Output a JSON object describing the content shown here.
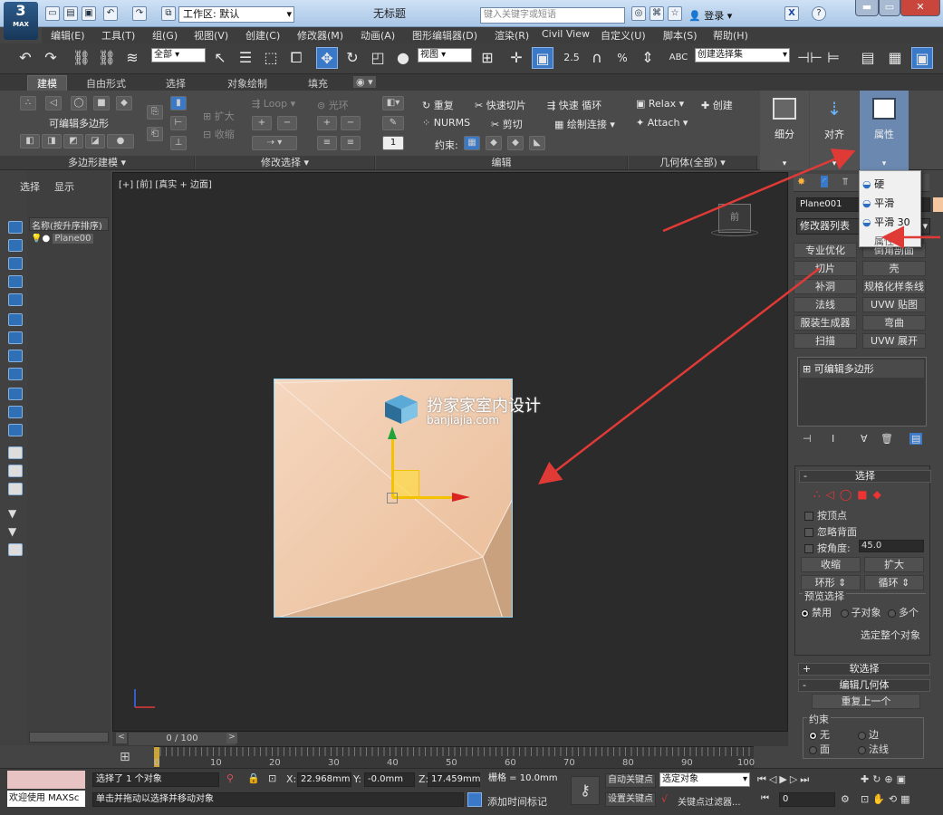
{
  "app": {
    "logo_label": "MAX",
    "workspace_label": "工作区: 默认",
    "window_title": "无标题",
    "search_placeholder": "键入关键字或短语",
    "login_label": "登录",
    "help_label": "?"
  },
  "menu": [
    "编辑(E)",
    "工具(T)",
    "组(G)",
    "视图(V)",
    "创建(C)",
    "修改器(M)",
    "动画(A)",
    "图形编辑器(D)",
    "渲染(R)",
    "Civil View",
    "自定义(U)",
    "脚本(S)",
    "帮助(H)"
  ],
  "toolbar": {
    "selection_filter": "全部",
    "ref_coord": "视图",
    "snap_labels": [
      "2.5",
      "%"
    ],
    "named_selection": "创建选择集"
  },
  "ribbon_tabs": [
    "建模",
    "自由形式",
    "选择",
    "对象绘制",
    "填充"
  ],
  "ribbon": {
    "poly_modeling": {
      "title": "可编辑多边形",
      "panel_label": "多边形建模"
    },
    "modify_selection": {
      "panel_label": "修改选择",
      "grow": "扩大",
      "shrink": "收缩",
      "loop": "Loop",
      "ring": "光环"
    },
    "edit": {
      "panel_label": "编辑",
      "repeat": "重复",
      "quickslice": "快速切片",
      "swiftloop": "快速 循环",
      "nurms": "NURMS",
      "cut": "剪切",
      "paintconnect": "绘制连接",
      "constraints_label": "约束:",
      "spinner_value": "1"
    },
    "geometry": {
      "panel_label": "几何体(全部)",
      "relax": "Relax",
      "create": "创建",
      "attach": "Attach"
    },
    "subdivision": "细分",
    "align": "对齐",
    "properties": "属性"
  },
  "properties_menu": {
    "items": [
      "硬",
      "平滑",
      "平滑 30"
    ],
    "footer": "属性"
  },
  "scene_explorer": {
    "tabs": [
      "选择",
      "显示"
    ],
    "column_header": "名称(按升序排序)",
    "object": "Plane00"
  },
  "viewport": {
    "label": "[+] [前] [真实 + 边面]",
    "watermark_title": "扮家家室内设计",
    "watermark_url": "banjiajia.com",
    "viewcube_label": "前"
  },
  "command_panel": {
    "object_name": "Plane001",
    "modifier_list": "修改器列表",
    "modifier_buttons": [
      "专业优化",
      "倒角剖面",
      "切片",
      "壳",
      "补洞",
      "规格化样条线",
      "法线",
      "UVW 贴图",
      "服装生成器",
      "弯曲",
      "扫描",
      "UVW 展开"
    ],
    "stack_item": "可编辑多边形",
    "selection": {
      "title": "选择",
      "by_vertex": "按顶点",
      "ignore_backfacing": "忽略背面",
      "by_angle": "按角度:",
      "angle_value": "45.0",
      "shrink": "收缩",
      "grow": "扩大",
      "ring": "环形",
      "loop": "循环",
      "preview_title": "预览选择",
      "preview_options": [
        "禁用",
        "子对象",
        "多个"
      ],
      "select_whole": "选定整个对象"
    },
    "soft_selection": "软选择",
    "edit_geometry": "编辑几何体",
    "repeat_last": "重复上一个",
    "constraints": {
      "title": "约束",
      "options": [
        "无",
        "边",
        "面",
        "法线"
      ]
    }
  },
  "timeline": {
    "frame_label": "0 / 100",
    "ticks": [
      "0",
      "10",
      "20",
      "30",
      "40",
      "50",
      "60",
      "70",
      "80",
      "90",
      "100"
    ]
  },
  "status": {
    "welcome": "欢迎使用 MAXSc",
    "selected": "选择了 1 个对象",
    "prompt": "单击并拖动以选择并移动对象",
    "x_label": "X:",
    "x_value": "22.968mm",
    "y_label": "Y:",
    "y_value": "-0.0mm",
    "z_label": "Z:",
    "z_value": "17.459mm",
    "grid": "栅格 = 10.0mm",
    "add_time_tag": "添加时间标记",
    "auto_key": "自动关键点",
    "set_key": "设置关键点",
    "key_mode": "选定对象",
    "key_filters": "关键点过滤器...",
    "frame_value": "0"
  },
  "colors": {
    "accent": "#6a88b0",
    "plane": "#f0c9a6",
    "arrow": "#e03a36",
    "gizmo_y": "#f3c200"
  }
}
